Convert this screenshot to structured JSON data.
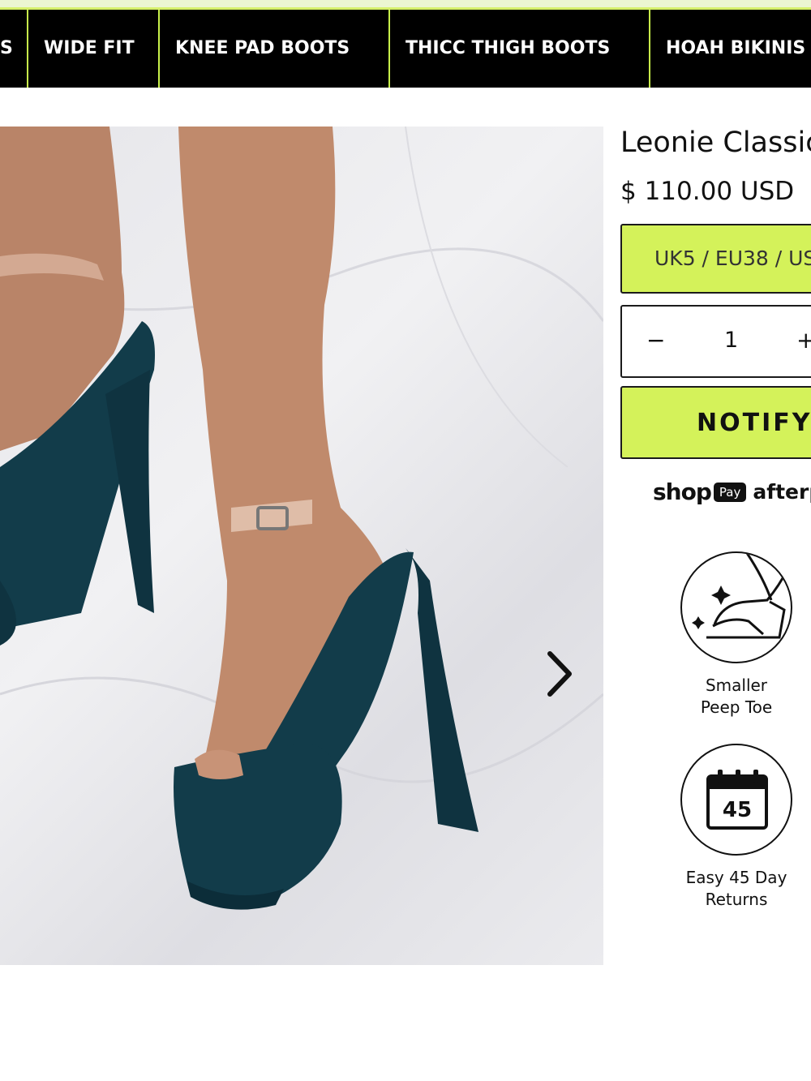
{
  "nav": {
    "items": [
      {
        "label": "S"
      },
      {
        "label": "WIDE FIT"
      },
      {
        "label": "KNEE PAD BOOTS"
      },
      {
        "label": "THICC THIGH BOOTS"
      },
      {
        "label": "HOAH BIKINIS"
      }
    ]
  },
  "gallery": {
    "image_alt": "Teal suede platform heels with clear straps",
    "next_icon": "chevron-right-icon"
  },
  "product": {
    "title": "Leonie Classic",
    "price": "$ 110.00 USD",
    "size_selected": "UK5 / EU38 / US",
    "quantity": "1",
    "minus_label": "−",
    "plus_label": "+",
    "notify_label": "NOTIFY",
    "payment": {
      "shop": "shop",
      "pay": "Pay",
      "afterpay": "afterp"
    }
  },
  "features": [
    {
      "line1": "Smaller",
      "line2": "Peep Toe",
      "icon": "peep-toe-shoe-icon"
    },
    {
      "line1": "Easy 45 Day",
      "line2": "Returns",
      "icon": "calendar-45-icon",
      "calendar_number": "45"
    }
  ],
  "colors": {
    "accent": "#d4f25a",
    "nav_bg": "#000000",
    "shoe": "#123c4a"
  }
}
